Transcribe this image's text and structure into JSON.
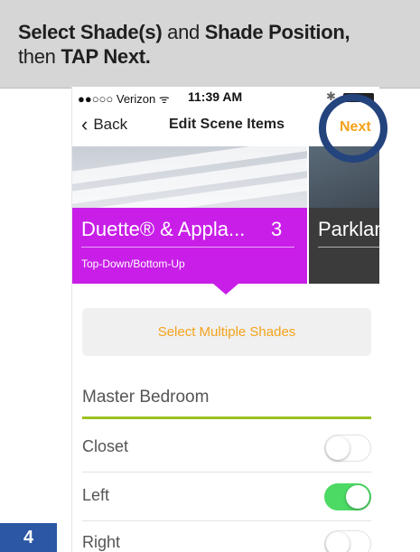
{
  "instruction": {
    "part1_bold": "Select Shade(s)",
    "part2": " and ",
    "part3_bold": "Shade Position,",
    "part4": "then ",
    "part5_bold": "TAP Next."
  },
  "status_bar": {
    "carrier": "●●○○○ Verizon ᯤ",
    "time": "11:39 AM",
    "bluetooth": "✱"
  },
  "nav": {
    "back_label": "Back",
    "title": "Edit Scene Items",
    "next_label": "Next"
  },
  "shades": [
    {
      "name": "Duette® & Appla...",
      "count": "3",
      "subtitle": "Top-Down/Bottom-Up"
    },
    {
      "name": "Parklan",
      "count": "",
      "subtitle": ""
    }
  ],
  "select_multiple_label": "Select Multiple Shades",
  "room": {
    "title": "Master Bedroom"
  },
  "positions": [
    {
      "label": "Closet",
      "on": false
    },
    {
      "label": "Left",
      "on": true
    },
    {
      "label": "Right",
      "on": false
    }
  ],
  "step_number": "4",
  "colors": {
    "accent_orange": "#f5a21a",
    "shade_purple": "#c81ee8",
    "toggle_green": "#4cd964",
    "room_underline": "#9ac122",
    "highlight_circle": "#24447e",
    "step_badge": "#2b57a4"
  }
}
